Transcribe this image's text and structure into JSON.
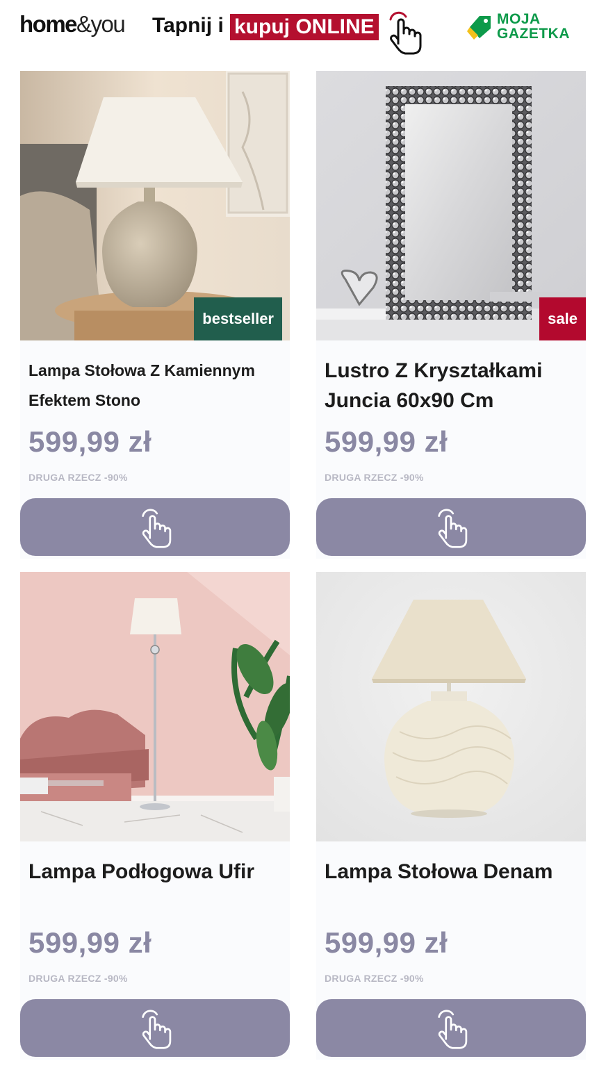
{
  "header": {
    "brand": {
      "home": "home",
      "amp_you": "&you"
    },
    "cta_prefix": "Tapnij i",
    "cta_highlight": "kupuj ONLINE",
    "partner_logo": {
      "line1": "MOJA",
      "line2": "GAZETKA"
    }
  },
  "colors": {
    "highlight_red": "#b4102f",
    "price_text": "#8a88a3",
    "button_bg": "#8b88a4",
    "bestseller_badge": "#215e4d",
    "sale_badge": "#b3092e",
    "partner_green": "#0d9a4a"
  },
  "products": [
    {
      "title": "Lampa Stołowa Z Kamiennym Efektem Stono",
      "price": "599,99 zł",
      "promo": "DRUGA RZECZ -90%",
      "badge": "bestseller",
      "button_icon": "tap-hand-icon"
    },
    {
      "title": "Lustro Z Kryształkami Juncia 60x90 Cm",
      "price": "599,99 zł",
      "promo": "DRUGA RZECZ -90%",
      "badge": "sale",
      "button_icon": "tap-hand-icon"
    },
    {
      "title": "Lampa Podłogowa Ufir",
      "price": "599,99 zł",
      "promo": "DRUGA RZECZ -90%",
      "badge": "",
      "button_icon": "tap-hand-icon"
    },
    {
      "title": "Lampa Stołowa Denam",
      "price": "599,99 zł",
      "promo": "DRUGA RZECZ -90%",
      "badge": "",
      "button_icon": "tap-hand-icon"
    }
  ]
}
